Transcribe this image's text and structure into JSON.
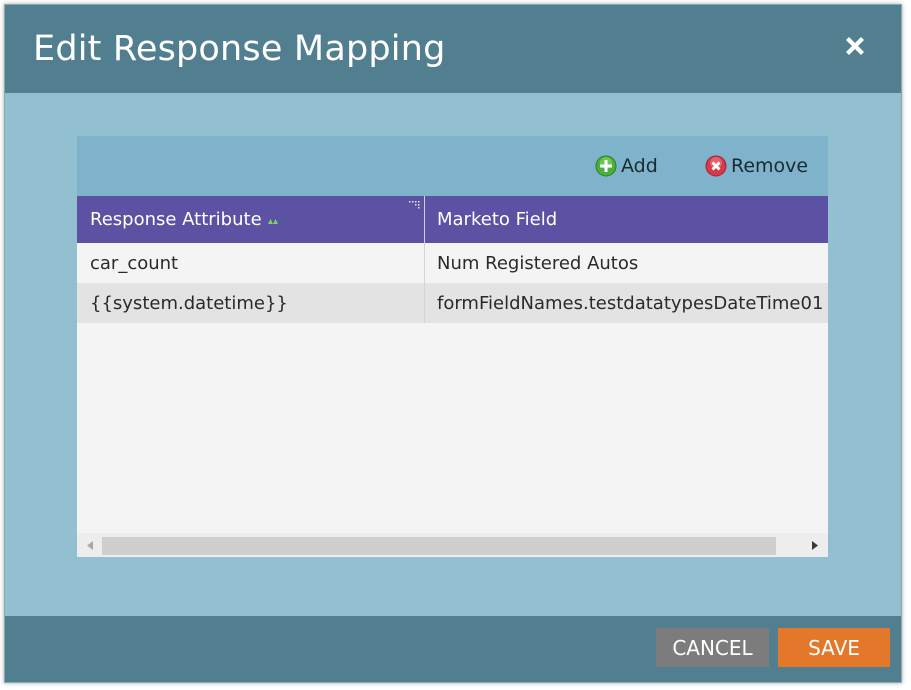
{
  "dialog": {
    "title": "Edit Response Mapping",
    "close_icon": "close-icon"
  },
  "toolbar": {
    "add_label": "Add",
    "remove_label": "Remove"
  },
  "table": {
    "columns": [
      "Response Attribute",
      "Marketo Field"
    ],
    "rows": [
      [
        "car_count",
        "Num Registered Autos"
      ],
      [
        "{{system.datetime}}",
        "formFieldNames.testdatatypesDateTime01"
      ]
    ]
  },
  "footer": {
    "cancel_label": "CANCEL",
    "save_label": "SAVE"
  },
  "colors": {
    "title_bar": "#527f90",
    "body": "#92c0d0",
    "toolbar": "#7fb3cc",
    "header": "#5b52a3",
    "save": "#e3782b",
    "cancel": "#7c7c7c"
  }
}
